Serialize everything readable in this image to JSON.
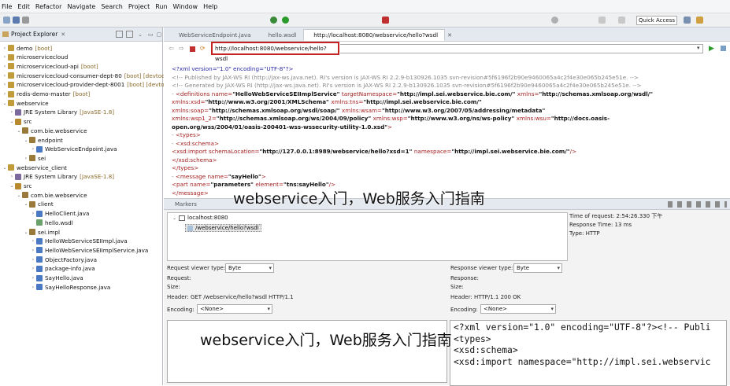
{
  "menu": [
    "File",
    "Edit",
    "Refactor",
    "Navigate",
    "Search",
    "Project",
    "Run",
    "Window",
    "Help"
  ],
  "quick_access": "Quick Access",
  "project_explorer": {
    "title": "Project Explorer",
    "tree": [
      {
        "label": "demo",
        "deco": "[boot]",
        "depth": 0,
        "tw": "›",
        "icon": "#c19a3a"
      },
      {
        "label": "microservicecloud",
        "deco": "",
        "depth": 0,
        "tw": "›",
        "icon": "#c19a3a"
      },
      {
        "label": "microservicecloud-api",
        "deco": "[boot]",
        "depth": 0,
        "tw": "›",
        "icon": "#c19a3a"
      },
      {
        "label": "microservicecloud-consumer-dept-80",
        "deco": "[boot] [devtool",
        "depth": 0,
        "tw": "›",
        "icon": "#c19a3a"
      },
      {
        "label": "microservicecloud-provider-dept-8001",
        "deco": "[boot] [devtoo",
        "depth": 0,
        "tw": "›",
        "icon": "#c19a3a"
      },
      {
        "label": "redis-demo-master",
        "deco": "[boot]",
        "depth": 0,
        "tw": "›",
        "icon": "#c19a3a"
      },
      {
        "label": "webservice",
        "deco": "",
        "depth": 0,
        "tw": "⌄",
        "icon": "#c19a3a"
      },
      {
        "label": "JRE System Library",
        "deco": "[JavaSE-1.8]",
        "depth": 1,
        "tw": "›",
        "icon": "#7a6a9e"
      },
      {
        "label": "src",
        "deco": "",
        "depth": 1,
        "tw": "⌄",
        "icon": "#b8892e"
      },
      {
        "label": "com.bie.webservice",
        "deco": "",
        "depth": 2,
        "tw": "⌄",
        "icon": "#9a7a3a"
      },
      {
        "label": "endpoint",
        "deco": "",
        "depth": 3,
        "tw": "⌄",
        "icon": "#9a7a3a"
      },
      {
        "label": "WebServiceEndpoint.java",
        "deco": "",
        "depth": 4,
        "tw": "›",
        "icon": "#4a78c2"
      },
      {
        "label": "sei",
        "deco": "",
        "depth": 3,
        "tw": "›",
        "icon": "#9a7a3a"
      },
      {
        "label": "webservice_client",
        "deco": "",
        "depth": 0,
        "tw": "⌄",
        "icon": "#c19a3a"
      },
      {
        "label": "JRE System Library",
        "deco": "[JavaSE-1.8]",
        "depth": 1,
        "tw": "›",
        "icon": "#7a6a9e"
      },
      {
        "label": "src",
        "deco": "",
        "depth": 1,
        "tw": "⌄",
        "icon": "#b8892e"
      },
      {
        "label": "com.bie.webservice",
        "deco": "",
        "depth": 2,
        "tw": "⌄",
        "icon": "#9a7a3a"
      },
      {
        "label": "client",
        "deco": "",
        "depth": 3,
        "tw": "⌄",
        "icon": "#9a7a3a"
      },
      {
        "label": "HelloClient.java",
        "deco": "",
        "depth": 4,
        "tw": "›",
        "icon": "#4a78c2"
      },
      {
        "label": "hello.wsdl",
        "deco": "",
        "depth": 4,
        "tw": "",
        "icon": "#6aa06a"
      },
      {
        "label": "sei.impl",
        "deco": "",
        "depth": 3,
        "tw": "⌄",
        "icon": "#9a7a3a"
      },
      {
        "label": "HelloWebServiceSEIImpl.java",
        "deco": "",
        "depth": 4,
        "tw": "›",
        "icon": "#4a78c2"
      },
      {
        "label": "HelloWebServiceSEIImplService.java",
        "deco": "",
        "depth": 4,
        "tw": "›",
        "icon": "#4a78c2"
      },
      {
        "label": "ObjectFactory.java",
        "deco": "",
        "depth": 4,
        "tw": "›",
        "icon": "#4a78c2"
      },
      {
        "label": "package-info.java",
        "deco": "",
        "depth": 4,
        "tw": "›",
        "icon": "#4a78c2"
      },
      {
        "label": "SayHello.java",
        "deco": "",
        "depth": 4,
        "tw": "›",
        "icon": "#4a78c2"
      },
      {
        "label": "SayHelloResponse.java",
        "deco": "",
        "depth": 4,
        "tw": "›",
        "icon": "#4a78c2"
      }
    ]
  },
  "editor": {
    "tabs": [
      "WebServiceEndpoint.java",
      "hello.wsdl",
      "http://localhost:8080/webservice/hello?wsdl"
    ],
    "url": "http://localhost:8080/webservice/hello?wsdl",
    "xml": [
      [
        [
          "<?xml version=\"1.0\" encoding=\"UTF-8\"?>",
          "bl"
        ]
      ],
      [
        [
          "<!-- Published by JAX-WS RI (http://jax-ws.java.net). RI's version is JAX-WS RI 2.2.9-b130926.1035 svn-revision#5f6196f2b90e9460065a4c2f4e30e065b245e51e. -->",
          "gr"
        ]
      ],
      [
        [
          "<!-- Generated by JAX-WS RI (http://jax-ws.java.net). RI's version is JAX-WS RI 2.2.9-b130926.1035 svn-revision#5f6196f2b90e9460065a4c2f4e30e065b245e51e. -->",
          "gr"
        ]
      ],
      [
        [
          "- ",
          "gr"
        ],
        [
          "<definitions ",
          "rd"
        ],
        [
          "name=",
          "rd"
        ],
        [
          "\"HelloWebServiceSEIImplService\" ",
          "bk"
        ],
        [
          "targetNamespace=",
          "rd"
        ],
        [
          "\"http://impl.sei.webservice.bie.com/\" ",
          "bk"
        ],
        [
          "xmlns=",
          "rd"
        ],
        [
          "\"http://schemas.xmlsoap.org/wsdl/\"",
          "bk"
        ]
      ],
      [
        [
          "xmlns:xsd=",
          "rd"
        ],
        [
          "\"http://www.w3.org/2001/XMLSchema\" ",
          "bk"
        ],
        [
          "xmlns:tns=",
          "rd"
        ],
        [
          "\"http://impl.sei.webservice.bie.com/\"",
          "bk"
        ]
      ],
      [
        [
          "xmlns:soap=",
          "rd"
        ],
        [
          "\"http://schemas.xmlsoap.org/wsdl/soap/\" ",
          "bk"
        ],
        [
          "xmlns:wsam=",
          "rd"
        ],
        [
          "\"http://www.w3.org/2007/05/addressing/metadata\"",
          "bk"
        ]
      ],
      [
        [
          "xmlns:wsp1_2=",
          "rd"
        ],
        [
          "\"http://schemas.xmlsoap.org/ws/2004/09/policy\" ",
          "bk"
        ],
        [
          "xmlns:wsp=",
          "rd"
        ],
        [
          "\"http://www.w3.org/ns/ws-policy\" ",
          "bk"
        ],
        [
          "xmlns:wsu=",
          "rd"
        ],
        [
          "\"http://docs.oasis-",
          "bk"
        ]
      ],
      [
        [
          "open.org/wss/2004/01/oasis-200401-wss-wssecurity-utility-1.0.xsd\"",
          "bk"
        ],
        [
          ">",
          "rd"
        ]
      ],
      [
        [
          "   - ",
          "gr"
        ],
        [
          "<types>",
          "rd"
        ]
      ],
      [
        [
          "      - ",
          "gr"
        ],
        [
          "<xsd:schema>",
          "rd"
        ]
      ],
      [
        [
          "            <xsd:import ",
          "rd"
        ],
        [
          "schemaLocation=",
          "rd"
        ],
        [
          "\"http://127.0.0.1:8989/webservice/hello?xsd=1\" ",
          "bk"
        ],
        [
          "namespace=",
          "rd"
        ],
        [
          "\"http://impl.sei.webservice.bie.com/\"",
          "bk"
        ],
        [
          "/>",
          "rd"
        ]
      ],
      [
        [
          "         </xsd:schema>",
          "rd"
        ]
      ],
      [
        [
          "      </types>",
          "rd"
        ]
      ],
      [
        [
          "   - ",
          "gr"
        ],
        [
          "<message ",
          "rd"
        ],
        [
          "name=",
          "rd"
        ],
        [
          "\"sayHello\"",
          "bk"
        ],
        [
          ">",
          "rd"
        ]
      ],
      [
        [
          "         <part ",
          "rd"
        ],
        [
          "name=",
          "rd"
        ],
        [
          "\"parameters\" ",
          "bk"
        ],
        [
          "element=",
          "rd"
        ],
        [
          "\"tns:sayHello\"",
          "bk"
        ],
        [
          "/>",
          "rd"
        ]
      ],
      [
        [
          "      </message>",
          "rd"
        ]
      ],
      [
        [
          "   - ",
          "gr"
        ],
        [
          "<message ",
          "rd"
        ],
        [
          "name=",
          "rd"
        ],
        [
          "\"sayHelloResponse\"",
          "bk"
        ],
        [
          ">",
          "rd"
        ]
      ]
    ]
  },
  "bottom": {
    "tabs": "Markers",
    "host": "localhost:8080",
    "path": "/webservice/hello?wsdl",
    "time_of_request": "Time of request: 2:54:26.330 下午",
    "response_time": "Response Time: 13 ms",
    "type": "Type: HTTP",
    "req_viewer_label": "Request viewer type:",
    "req_viewer_value": "Byte",
    "req_request": "Request:",
    "req_size": "Size:",
    "req_header": "Header: GET /webservice/hello?wsdl HTTP/1.1",
    "req_encoding_label": "Encoding:",
    "req_encoding_value": "<None>",
    "resp_viewer_label": "Response viewer type:",
    "resp_viewer_value": "Byte",
    "resp_response": "Response:",
    "resp_size": "Size:",
    "resp_header": "Header: HTTP/1.1 200 OK",
    "resp_encoding_label": "Encoding:",
    "resp_encoding_value": "<None>",
    "response_body": [
      "<?xml version=\"1.0\" encoding=\"UTF-8\"?><!-- Publi",
      "<types>",
      "<xsd:schema>",
      "<xsd:import namespace=\"http://impl.sei.webservic"
    ]
  },
  "watermark": {
    "top": "webservice入门，Web服务入门指南",
    "bottom": "webservice入门，Web服务入门指南"
  }
}
